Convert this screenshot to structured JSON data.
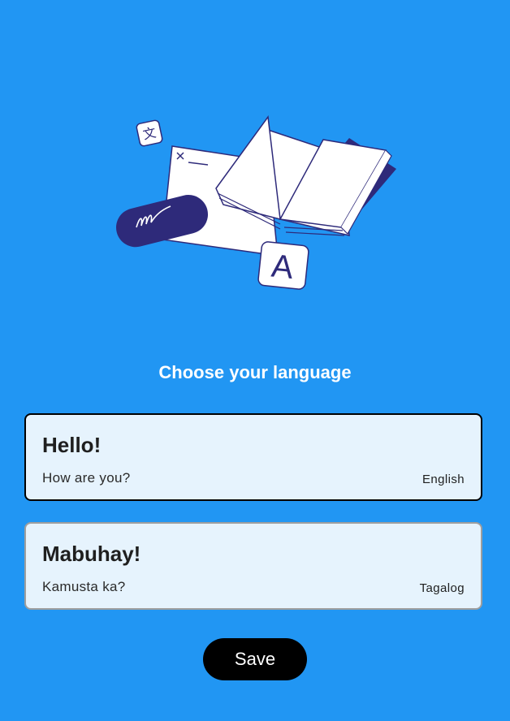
{
  "screen": {
    "title": "Choose your language"
  },
  "languages": [
    {
      "greeting": "Hello!",
      "question": "How are you?",
      "language": "English",
      "selected": true
    },
    {
      "greeting": "Mabuhay!",
      "question": "Kamusta ka?",
      "language": "Tagalog",
      "selected": false
    }
  ],
  "illustration": {
    "icon": "book-translation-illustration",
    "letter_tile": "A",
    "translate_glyph": "文"
  },
  "actions": {
    "save_label": "Save"
  },
  "colors": {
    "background": "#2196F3",
    "card_background": "#E6F3FD",
    "selected_border": "#000000",
    "unselected_border": "#9E9E9E",
    "accent_dark": "#2E2A7A",
    "button": "#000000"
  }
}
